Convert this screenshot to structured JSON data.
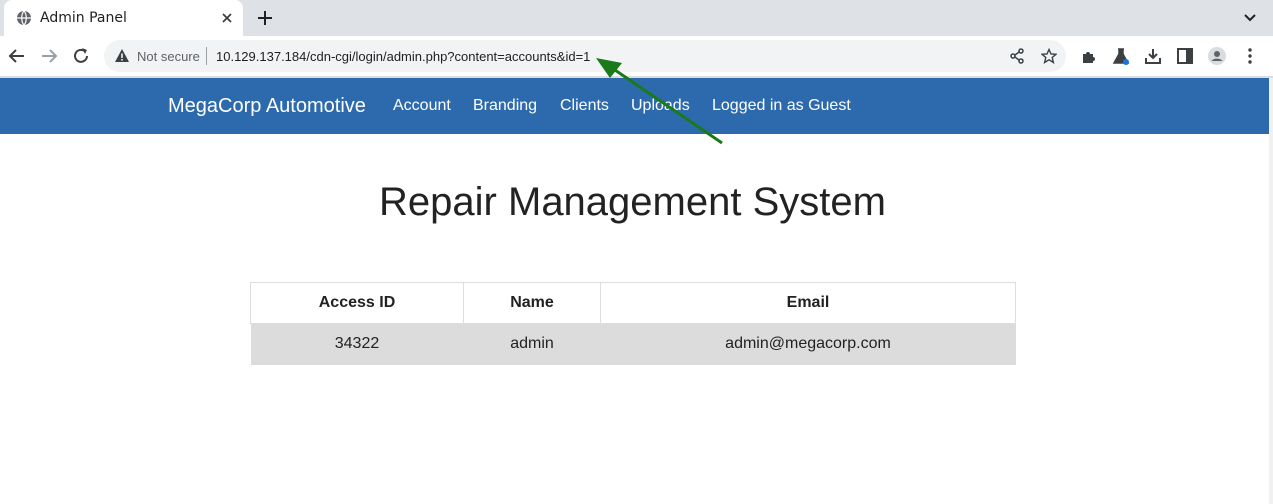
{
  "browser": {
    "tab": {
      "title": "Admin Panel"
    },
    "omnibox": {
      "security_label": "Not secure",
      "url_host": "10.129.137.184",
      "url_path": "/cdn-cgi/login/admin.php?content=accounts&id=1"
    }
  },
  "site": {
    "brand": "MegaCorp Automotive",
    "nav": {
      "account": "Account",
      "branding": "Branding",
      "clients": "Clients",
      "uploads": "Uploads",
      "logged_in": "Logged in as Guest"
    },
    "page_title": "Repair Management System",
    "table": {
      "headers": {
        "access_id": "Access ID",
        "name": "Name",
        "email": "Email"
      },
      "rows": [
        {
          "access_id": "34322",
          "name": "admin",
          "email": "admin@megacorp.com"
        }
      ]
    }
  },
  "colors": {
    "nav_background": "#2c6aad",
    "row_background": "#dcdcdc",
    "annotation_arrow": "#1a7a1a"
  }
}
